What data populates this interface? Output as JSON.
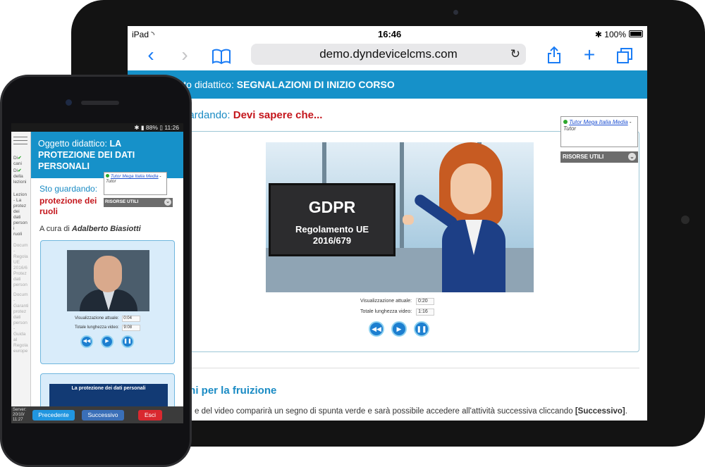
{
  "ipad": {
    "status": {
      "device": "iPad",
      "time": "16:46",
      "battery": "100%"
    },
    "nav": {
      "url": "demo.dyndevicelcms.com",
      "back_icon": "chevron-left-icon",
      "forward_icon": "chevron-right-icon",
      "bookmarks_icon": "book-icon",
      "reload_icon": "reload-icon",
      "share_icon": "share-icon",
      "add_icon": "plus-icon",
      "tabs_icon": "tabs-icon"
    },
    "header": {
      "label": "ggetto didattico:",
      "title": "SEGNALAZIONI DI INIZIO CORSO"
    },
    "watching": {
      "label": "uardando:",
      "title": "Devi sapere che..."
    },
    "tutor": {
      "name": "Tutor Mega Italia Media",
      "sep": " -",
      "role": "Tutor"
    },
    "risorse": "RISORSE UTILI",
    "video": {
      "slide_title": "GDPR",
      "slide_line1": "Regolamento UE",
      "slide_line2": "2016/679",
      "current_label": "Visualizzazione attuale:",
      "current_value": "0:20",
      "total_label": "Totale lunghezza video:",
      "total_value": "1:16"
    },
    "section_title": "oni per la fruizione",
    "body_text": "e del video comparirà un segno di spunta verde e sarà possibile accedere all'attività successiva cliccando",
    "body_bold": "[Successivo]",
    "body_end": "."
  },
  "iphone": {
    "status": {
      "battery": "88%",
      "time": "11:26"
    },
    "sidebar": {
      "item1": "Di",
      "item1b": "cani",
      "item2": "Di",
      "item2b": "della",
      "item2c": "lezioni",
      "item3": "Lezion\n- La\nprotez\ndei\ndati\nperson\ni\nruoli",
      "item4": "Docum\n-\nRegola\nUE\n2016/6\nProtez\ndati\nperson",
      "item5": "Docum\n-\nGaranti\nprotez\ndati\nperson\n-\nGuida\nal\nRegola\neurope"
    },
    "header": {
      "label": "Oggetto didattico:",
      "title1": "LA",
      "title2": "PROTEZIONE DEI DATI",
      "title3": "PERSONALI"
    },
    "watching": {
      "label": "Sto guardando:",
      "title": "protezione dei",
      "title2": "ruoli"
    },
    "tutor": {
      "name": "Tutor Mega Italia Media",
      "sep": " -",
      "role": "Tutor"
    },
    "risorse": "RISORSE UTILI",
    "author": {
      "label": "A cura di",
      "name": "Adalberto Biasiotti"
    },
    "video": {
      "current_label": "Visualizzazione attuale:",
      "current_value": "0:04",
      "total_label": "Totale lunghezza video:",
      "total_value": "9:08"
    },
    "slide2_title": "La protezione dei dati personali",
    "footer": {
      "server": "Server:\n20/10/\n11:27",
      "prev": "Precedente",
      "next": "Successivo",
      "exit": "Esci"
    }
  },
  "colors": {
    "accent": "#1691c9",
    "title_red": "#c4161c",
    "link_blue": "#1a8bc4"
  }
}
